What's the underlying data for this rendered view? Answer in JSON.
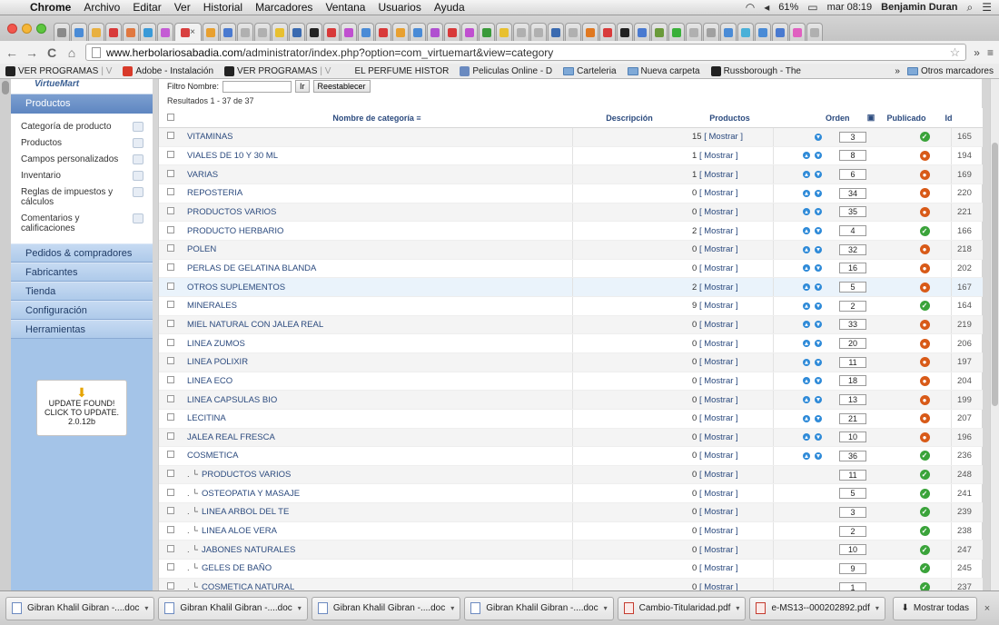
{
  "menubar": {
    "app": "Chrome",
    "menus": [
      "Archivo",
      "Editar",
      "Ver",
      "Historial",
      "Marcadores",
      "Ventana",
      "Usuarios",
      "Ayuda"
    ],
    "battery": "61%",
    "clock": "mar 08:19",
    "user": "Benjamin Duran"
  },
  "tabs": {
    "favicon_colors": [
      "#8a8a8a",
      "#4a8bd6",
      "#e8b040",
      "#d83a3a",
      "#e07840",
      "#3a9ad8",
      "#c45cd4",
      "#d84040",
      "#e8a030",
      "#4a7ad0",
      "#b0b0b0",
      "#b0b0b0",
      "#e8c030",
      "#3a6ab0",
      "#222222",
      "#d83a3a",
      "#c050d0",
      "#4a8bd6",
      "#d83a3a",
      "#e8a030",
      "#4a8bd6",
      "#b050d0",
      "#d83a3a",
      "#c050d0",
      "#3a9a3a",
      "#e8c030",
      "#b0b0b0",
      "#b0b0b0",
      "#3a6ab0",
      "#b0b0b0",
      "#e07820",
      "#d83a3a",
      "#222222",
      "#4a7ad0",
      "#6a9a3a",
      "#3ab03a",
      "#b0b0b0",
      "#a0a0a0",
      "#4a8bd6",
      "#4ab0d8",
      "#4a8bd6",
      "#4a7ad0",
      "#e060c0",
      "#b0b0b0"
    ],
    "active_index": 7,
    "active_close": "×"
  },
  "toolbar": {
    "back": "←",
    "forward": "→",
    "reload": "C",
    "home": "⌂",
    "url_host": "www.herbolariosabadia.com",
    "url_path": "/administrator/index.php?option=com_virtuemart&view=category",
    "star": "☆",
    "more": "»"
  },
  "bookmarks": {
    "items": [
      {
        "label": "VER PROGRAMAS",
        "suffix": " | V",
        "color": "#222222"
      },
      {
        "label": "Adobe - Instalación",
        "suffix": "",
        "color": "#d83a2a"
      },
      {
        "label": "VER PROGRAMAS",
        "suffix": " | V",
        "color": "#222222"
      },
      {
        "label": "EL PERFUME HISTOR",
        "suffix": "",
        "color": "#ebebeb"
      },
      {
        "label": "Peliculas Online - D",
        "suffix": "",
        "color": "#6a8ac0"
      },
      {
        "label": "Carteleria",
        "suffix": "",
        "folder": true
      },
      {
        "label": "Nueva carpeta",
        "suffix": "",
        "folder": true
      },
      {
        "label": "Russborough - The",
        "suffix": "",
        "color": "#222222"
      }
    ],
    "more": "»",
    "other": "Otros marcadores"
  },
  "sidebar": {
    "logo": "VirtueMart",
    "header": "Productos",
    "sub_items": [
      "Categoría de producto",
      "Productos",
      "Campos personalizados",
      "Inventario",
      "Reglas de impuestos y cálculos",
      "Comentarios y calificaciones"
    ],
    "main_items": [
      "Pedidos & compradores",
      "Fabricantes",
      "Tienda",
      "Configuración",
      "Herramientas"
    ],
    "update": {
      "arrow": "⬇",
      "line1": "UPDATE FOUND!",
      "line2": "CLICK TO UPDATE.",
      "version": "2.0.12b"
    }
  },
  "filter": {
    "label": "Filtro Nombre:",
    "value": "",
    "go": "Ir",
    "reset": "Reestablecer"
  },
  "results": "Resultados 1 - 37 de 37",
  "table": {
    "headers": {
      "name": "Nombre de categoría",
      "sort_icon": "≡",
      "desc": "Descripción",
      "products": "Productos",
      "order": "Orden",
      "save_icon": "▣",
      "published": "Publicado",
      "id": "Id"
    },
    "show_label": "[ Mostrar ]",
    "rows": [
      {
        "name": "VITAMINAS",
        "prefix": "",
        "count": "15",
        "up": false,
        "down": true,
        "order": "3",
        "published": true,
        "id": "165",
        "hl": false
      },
      {
        "name": "VIALES DE 10 Y 30 ML",
        "prefix": "",
        "count": "1",
        "up": true,
        "down": true,
        "order": "8",
        "published": false,
        "id": "194",
        "hl": false
      },
      {
        "name": "VARIAS",
        "prefix": "",
        "count": "1",
        "up": true,
        "down": true,
        "order": "6",
        "published": false,
        "id": "169",
        "hl": false
      },
      {
        "name": "REPOSTERIA",
        "prefix": "",
        "count": "0",
        "up": true,
        "down": true,
        "order": "34",
        "published": false,
        "id": "220",
        "hl": false
      },
      {
        "name": "PRODUCTOS VARIOS",
        "prefix": "",
        "count": "0",
        "up": true,
        "down": true,
        "order": "35",
        "published": false,
        "id": "221",
        "hl": false
      },
      {
        "name": "PRODUCTO HERBARIO",
        "prefix": "",
        "count": "2",
        "up": true,
        "down": true,
        "order": "4",
        "published": true,
        "id": "166",
        "hl": false
      },
      {
        "name": "POLEN",
        "prefix": "",
        "count": "0",
        "up": true,
        "down": true,
        "order": "32",
        "published": false,
        "id": "218",
        "hl": false
      },
      {
        "name": "PERLAS DE GELATINA BLANDA",
        "prefix": "",
        "count": "0",
        "up": true,
        "down": true,
        "order": "16",
        "published": false,
        "id": "202",
        "hl": false
      },
      {
        "name": "OTROS SUPLEMENTOS",
        "prefix": "",
        "count": "2",
        "up": true,
        "down": true,
        "order": "5",
        "published": false,
        "id": "167",
        "hl": true
      },
      {
        "name": "MINERALES",
        "prefix": "",
        "count": "9",
        "up": true,
        "down": true,
        "order": "2",
        "published": true,
        "id": "164",
        "hl": false
      },
      {
        "name": "MIEL NATURAL CON JALEA REAL",
        "prefix": "",
        "count": "0",
        "up": true,
        "down": true,
        "order": "33",
        "published": false,
        "id": "219",
        "hl": false
      },
      {
        "name": "LINEA ZUMOS",
        "prefix": "",
        "count": "0",
        "up": true,
        "down": true,
        "order": "20",
        "published": false,
        "id": "206",
        "hl": false
      },
      {
        "name": "LINEA POLIXIR",
        "prefix": "",
        "count": "0",
        "up": true,
        "down": true,
        "order": "11",
        "published": false,
        "id": "197",
        "hl": false
      },
      {
        "name": "LINEA ECO",
        "prefix": "",
        "count": "0",
        "up": true,
        "down": true,
        "order": "18",
        "published": false,
        "id": "204",
        "hl": false
      },
      {
        "name": "LINEA CAPSULAS BIO",
        "prefix": "",
        "count": "0",
        "up": true,
        "down": true,
        "order": "13",
        "published": false,
        "id": "199",
        "hl": false
      },
      {
        "name": "LECITINA",
        "prefix": "",
        "count": "0",
        "up": true,
        "down": true,
        "order": "21",
        "published": false,
        "id": "207",
        "hl": false
      },
      {
        "name": "JALEA REAL FRESCA",
        "prefix": "",
        "count": "0",
        "up": true,
        "down": true,
        "order": "10",
        "published": false,
        "id": "196",
        "hl": false
      },
      {
        "name": "COSMETICA",
        "prefix": "",
        "count": "0",
        "up": true,
        "down": true,
        "order": "36",
        "published": true,
        "id": "236",
        "hl": false
      },
      {
        "name": "PRODUCTOS VARIOS",
        "prefix": ". └",
        "count": "0",
        "up": false,
        "down": false,
        "order": "11",
        "published": true,
        "id": "248",
        "hl": false
      },
      {
        "name": "OSTEOPATIA Y MASAJE",
        "prefix": ". └",
        "count": "0",
        "up": false,
        "down": false,
        "order": "5",
        "published": true,
        "id": "241",
        "hl": false
      },
      {
        "name": "LINEA ARBOL DEL TE",
        "prefix": ". └",
        "count": "0",
        "up": false,
        "down": false,
        "order": "3",
        "published": true,
        "id": "239",
        "hl": false
      },
      {
        "name": "LINEA ALOE VERA",
        "prefix": ". └",
        "count": "0",
        "up": false,
        "down": false,
        "order": "2",
        "published": true,
        "id": "238",
        "hl": false
      },
      {
        "name": "JABONES NATURALES",
        "prefix": ". └",
        "count": "0",
        "up": false,
        "down": false,
        "order": "10",
        "published": true,
        "id": "247",
        "hl": false
      },
      {
        "name": "GELES DE BAÑO",
        "prefix": ". └",
        "count": "0",
        "up": false,
        "down": false,
        "order": "9",
        "published": true,
        "id": "245",
        "hl": false
      },
      {
        "name": "COSMETICA NATURAL",
        "prefix": ". └",
        "count": "0",
        "up": false,
        "down": false,
        "order": "1",
        "published": true,
        "id": "237",
        "hl": false
      }
    ]
  },
  "shelf": {
    "downloads": [
      {
        "name": "Gibran Khalil Gibran -....doc",
        "type": "doc"
      },
      {
        "name": "Gibran Khalil Gibran -....doc",
        "type": "doc"
      },
      {
        "name": "Gibran Khalil Gibran -....doc",
        "type": "doc"
      },
      {
        "name": "Gibran Khalil Gibran -....doc",
        "type": "doc"
      },
      {
        "name": "Cambio-Titularidad.pdf",
        "type": "pdf"
      },
      {
        "name": "e-MS13--000202892.pdf",
        "type": "pdf"
      }
    ],
    "chevron": "▾",
    "show_all": "Mostrar todas",
    "close": "×"
  }
}
